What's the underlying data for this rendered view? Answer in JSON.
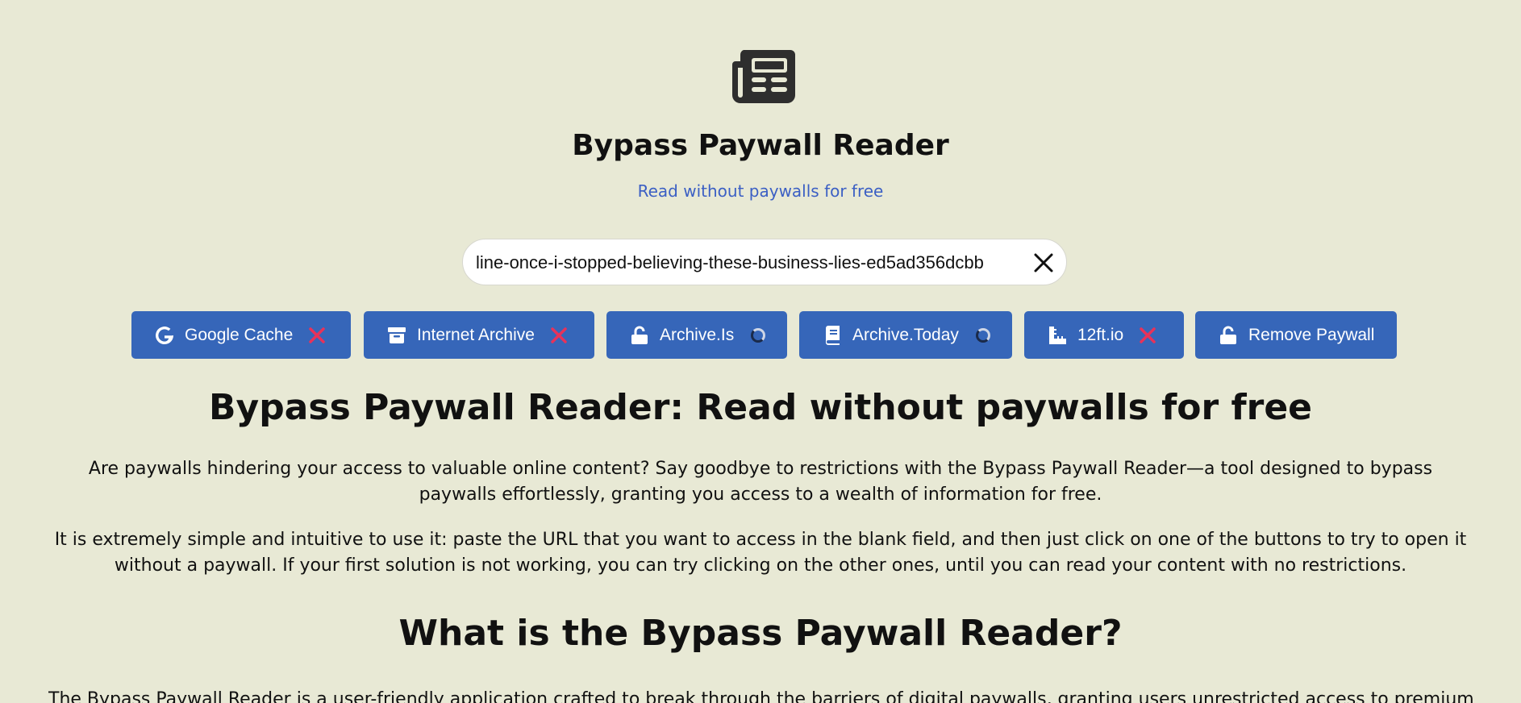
{
  "header": {
    "logo_icon": "newspaper-icon",
    "title": "Bypass Paywall Reader",
    "subtitle": "Read without paywalls for free"
  },
  "search": {
    "value": "line-once-i-stopped-believing-these-business-lies-ed5ad356dcbb",
    "clear_icon": "close-icon"
  },
  "services": [
    {
      "label": "Google Cache",
      "icon": "google-icon",
      "status": "failed"
    },
    {
      "label": "Internet Archive",
      "icon": "archive-box-icon",
      "status": "failed"
    },
    {
      "label": "Archive.Is",
      "icon": "unlock-icon",
      "status": "loading"
    },
    {
      "label": "Archive.Today",
      "icon": "book-icon",
      "status": "loading"
    },
    {
      "label": "12ft.io",
      "icon": "ruler-icon",
      "status": "failed"
    },
    {
      "label": "Remove Paywall",
      "icon": "unlock-icon",
      "status": "none"
    }
  ],
  "content": {
    "headline": "Bypass Paywall Reader: Read without paywalls for free",
    "paragraph1": "Are paywalls hindering your access to valuable online content? Say goodbye to restrictions with the Bypass Paywall Reader—a tool designed to bypass paywalls effortlessly, granting you access to a wealth of information for free.",
    "paragraph2": "It is extremely simple and intuitive to use it: paste the URL that you want to access in the blank field, and then just click on one of the buttons to try to open it without a paywall. If your first solution is not working, you can try clicking on the other ones, until you can read your content with no restrictions.",
    "headline2": "What is the Bypass Paywall Reader?",
    "paragraph3": "The Bypass Paywall Reader is a user-friendly application crafted to break through the barriers of digital paywalls, granting users unrestricted access to premium content"
  },
  "colors": {
    "background": "#e8e9d5",
    "button": "#3666b9",
    "subtitle": "#3b5fc4",
    "fail_mark": "#e8325a"
  }
}
